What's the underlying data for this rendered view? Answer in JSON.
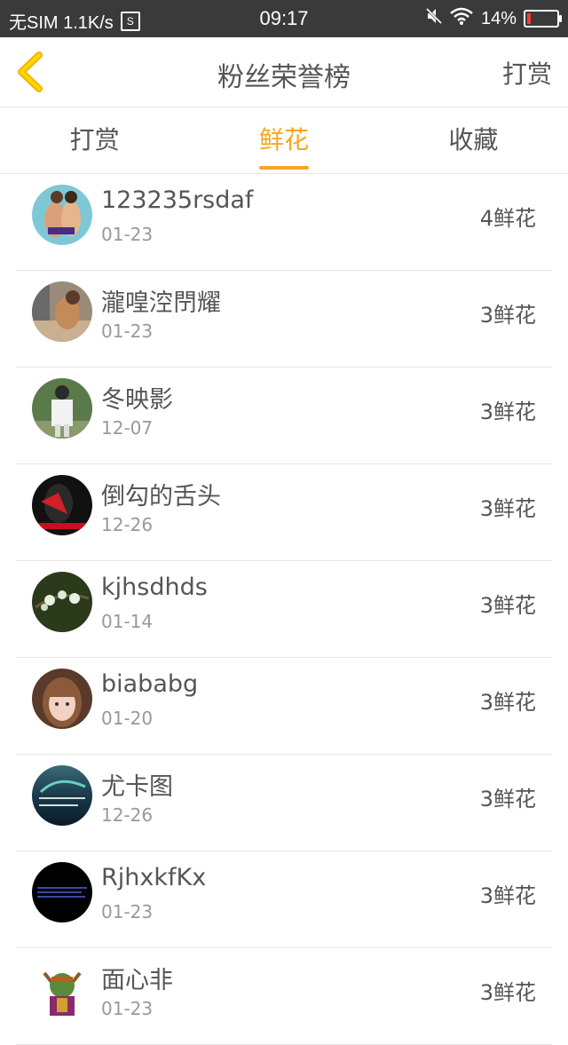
{
  "status": {
    "left_text": "无SIM 1.1K/s",
    "sim_badge": "S",
    "time": "09:17",
    "battery": "14%",
    "battery_level": 0.14
  },
  "header": {
    "title": "粉丝荣誉榜",
    "action": "打赏"
  },
  "tabs": [
    {
      "label": "打赏",
      "active": false
    },
    {
      "label": "鲜花",
      "active": true
    },
    {
      "label": "收藏",
      "active": false
    }
  ],
  "colors": {
    "accent": "#f5a623",
    "text": "#555555",
    "muted": "#999999"
  },
  "list": [
    {
      "name": "123235rsdaf",
      "date": "01-23",
      "count": "4鲜花"
    },
    {
      "name": "瀧喤涳閅耀",
      "date": "01-23",
      "count": "3鲜花"
    },
    {
      "name": "冬映影",
      "date": "12-07",
      "count": "3鲜花"
    },
    {
      "name": "倒勾的舌头",
      "date": "12-26",
      "count": "3鲜花"
    },
    {
      "name": "kjhsdhds",
      "date": "01-14",
      "count": "3鲜花"
    },
    {
      "name": "biababg",
      "date": "01-20",
      "count": "3鲜花"
    },
    {
      "name": "尤卡图",
      "date": "12-26",
      "count": "3鲜花"
    },
    {
      "name": "RjhxkfKx",
      "date": "01-23",
      "count": "3鲜花"
    },
    {
      "name": "面心非",
      "date": "01-23",
      "count": "3鲜花"
    }
  ]
}
